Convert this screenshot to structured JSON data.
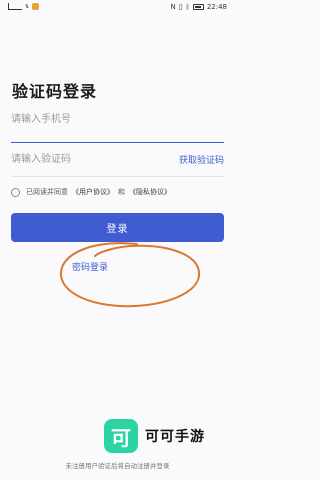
{
  "status_bar": {
    "time": "22:48",
    "left_icons": [
      "signal-icon",
      "wifi-speed-icon",
      "app-notification-icon"
    ],
    "right_icons": [
      "nfc-icon",
      "vibrate-icon",
      "bluetooth-icon",
      "battery-icon"
    ]
  },
  "page": {
    "title": "验证码登录"
  },
  "phone": {
    "placeholder": "请输入手机号"
  },
  "code": {
    "placeholder": "请输入验证码",
    "get_code_label": "获取验证码"
  },
  "agreement": {
    "prefix": "已阅读并同意",
    "user_agreement": "《用户协议》",
    "and": "和",
    "privacy_agreement": "《隐私协议》"
  },
  "login_button": "登录",
  "password_login_link": "密码登录",
  "watermark": {
    "logo_char": "可",
    "text": "可可手游"
  },
  "footnote": "未注册用户验证后将自动注册并登录",
  "colors": {
    "accent": "#3f5dd0",
    "annotation": "#d9782e",
    "watermark_logo": "#2cd3a4"
  }
}
